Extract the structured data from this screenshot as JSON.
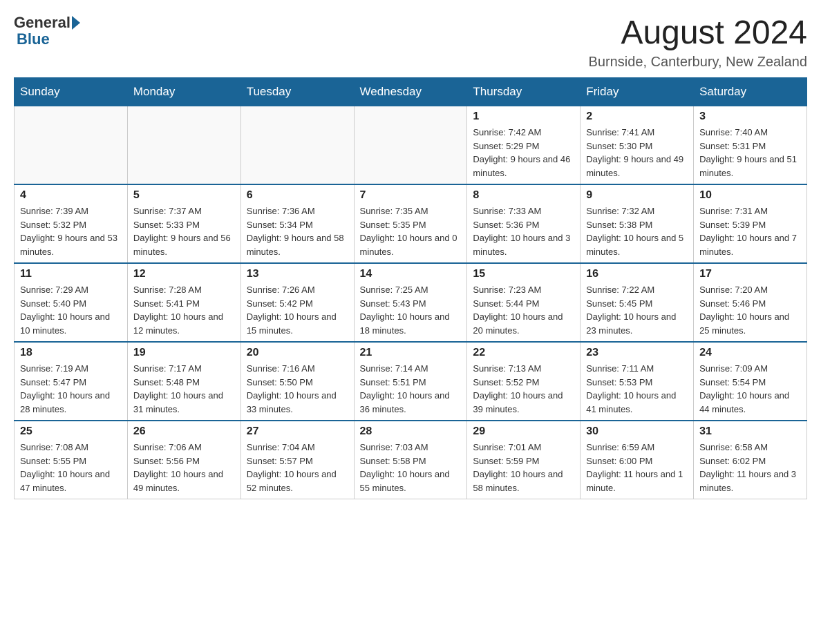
{
  "header": {
    "logo_general": "General",
    "logo_blue": "Blue",
    "title": "August 2024",
    "location": "Burnside, Canterbury, New Zealand"
  },
  "days_of_week": [
    "Sunday",
    "Monday",
    "Tuesday",
    "Wednesday",
    "Thursday",
    "Friday",
    "Saturday"
  ],
  "weeks": [
    [
      {
        "day": "",
        "info": ""
      },
      {
        "day": "",
        "info": ""
      },
      {
        "day": "",
        "info": ""
      },
      {
        "day": "",
        "info": ""
      },
      {
        "day": "1",
        "info": "Sunrise: 7:42 AM\nSunset: 5:29 PM\nDaylight: 9 hours and 46 minutes."
      },
      {
        "day": "2",
        "info": "Sunrise: 7:41 AM\nSunset: 5:30 PM\nDaylight: 9 hours and 49 minutes."
      },
      {
        "day": "3",
        "info": "Sunrise: 7:40 AM\nSunset: 5:31 PM\nDaylight: 9 hours and 51 minutes."
      }
    ],
    [
      {
        "day": "4",
        "info": "Sunrise: 7:39 AM\nSunset: 5:32 PM\nDaylight: 9 hours and 53 minutes."
      },
      {
        "day": "5",
        "info": "Sunrise: 7:37 AM\nSunset: 5:33 PM\nDaylight: 9 hours and 56 minutes."
      },
      {
        "day": "6",
        "info": "Sunrise: 7:36 AM\nSunset: 5:34 PM\nDaylight: 9 hours and 58 minutes."
      },
      {
        "day": "7",
        "info": "Sunrise: 7:35 AM\nSunset: 5:35 PM\nDaylight: 10 hours and 0 minutes."
      },
      {
        "day": "8",
        "info": "Sunrise: 7:33 AM\nSunset: 5:36 PM\nDaylight: 10 hours and 3 minutes."
      },
      {
        "day": "9",
        "info": "Sunrise: 7:32 AM\nSunset: 5:38 PM\nDaylight: 10 hours and 5 minutes."
      },
      {
        "day": "10",
        "info": "Sunrise: 7:31 AM\nSunset: 5:39 PM\nDaylight: 10 hours and 7 minutes."
      }
    ],
    [
      {
        "day": "11",
        "info": "Sunrise: 7:29 AM\nSunset: 5:40 PM\nDaylight: 10 hours and 10 minutes."
      },
      {
        "day": "12",
        "info": "Sunrise: 7:28 AM\nSunset: 5:41 PM\nDaylight: 10 hours and 12 minutes."
      },
      {
        "day": "13",
        "info": "Sunrise: 7:26 AM\nSunset: 5:42 PM\nDaylight: 10 hours and 15 minutes."
      },
      {
        "day": "14",
        "info": "Sunrise: 7:25 AM\nSunset: 5:43 PM\nDaylight: 10 hours and 18 minutes."
      },
      {
        "day": "15",
        "info": "Sunrise: 7:23 AM\nSunset: 5:44 PM\nDaylight: 10 hours and 20 minutes."
      },
      {
        "day": "16",
        "info": "Sunrise: 7:22 AM\nSunset: 5:45 PM\nDaylight: 10 hours and 23 minutes."
      },
      {
        "day": "17",
        "info": "Sunrise: 7:20 AM\nSunset: 5:46 PM\nDaylight: 10 hours and 25 minutes."
      }
    ],
    [
      {
        "day": "18",
        "info": "Sunrise: 7:19 AM\nSunset: 5:47 PM\nDaylight: 10 hours and 28 minutes."
      },
      {
        "day": "19",
        "info": "Sunrise: 7:17 AM\nSunset: 5:48 PM\nDaylight: 10 hours and 31 minutes."
      },
      {
        "day": "20",
        "info": "Sunrise: 7:16 AM\nSunset: 5:50 PM\nDaylight: 10 hours and 33 minutes."
      },
      {
        "day": "21",
        "info": "Sunrise: 7:14 AM\nSunset: 5:51 PM\nDaylight: 10 hours and 36 minutes."
      },
      {
        "day": "22",
        "info": "Sunrise: 7:13 AM\nSunset: 5:52 PM\nDaylight: 10 hours and 39 minutes."
      },
      {
        "day": "23",
        "info": "Sunrise: 7:11 AM\nSunset: 5:53 PM\nDaylight: 10 hours and 41 minutes."
      },
      {
        "day": "24",
        "info": "Sunrise: 7:09 AM\nSunset: 5:54 PM\nDaylight: 10 hours and 44 minutes."
      }
    ],
    [
      {
        "day": "25",
        "info": "Sunrise: 7:08 AM\nSunset: 5:55 PM\nDaylight: 10 hours and 47 minutes."
      },
      {
        "day": "26",
        "info": "Sunrise: 7:06 AM\nSunset: 5:56 PM\nDaylight: 10 hours and 49 minutes."
      },
      {
        "day": "27",
        "info": "Sunrise: 7:04 AM\nSunset: 5:57 PM\nDaylight: 10 hours and 52 minutes."
      },
      {
        "day": "28",
        "info": "Sunrise: 7:03 AM\nSunset: 5:58 PM\nDaylight: 10 hours and 55 minutes."
      },
      {
        "day": "29",
        "info": "Sunrise: 7:01 AM\nSunset: 5:59 PM\nDaylight: 10 hours and 58 minutes."
      },
      {
        "day": "30",
        "info": "Sunrise: 6:59 AM\nSunset: 6:00 PM\nDaylight: 11 hours and 1 minute."
      },
      {
        "day": "31",
        "info": "Sunrise: 6:58 AM\nSunset: 6:02 PM\nDaylight: 11 hours and 3 minutes."
      }
    ]
  ]
}
